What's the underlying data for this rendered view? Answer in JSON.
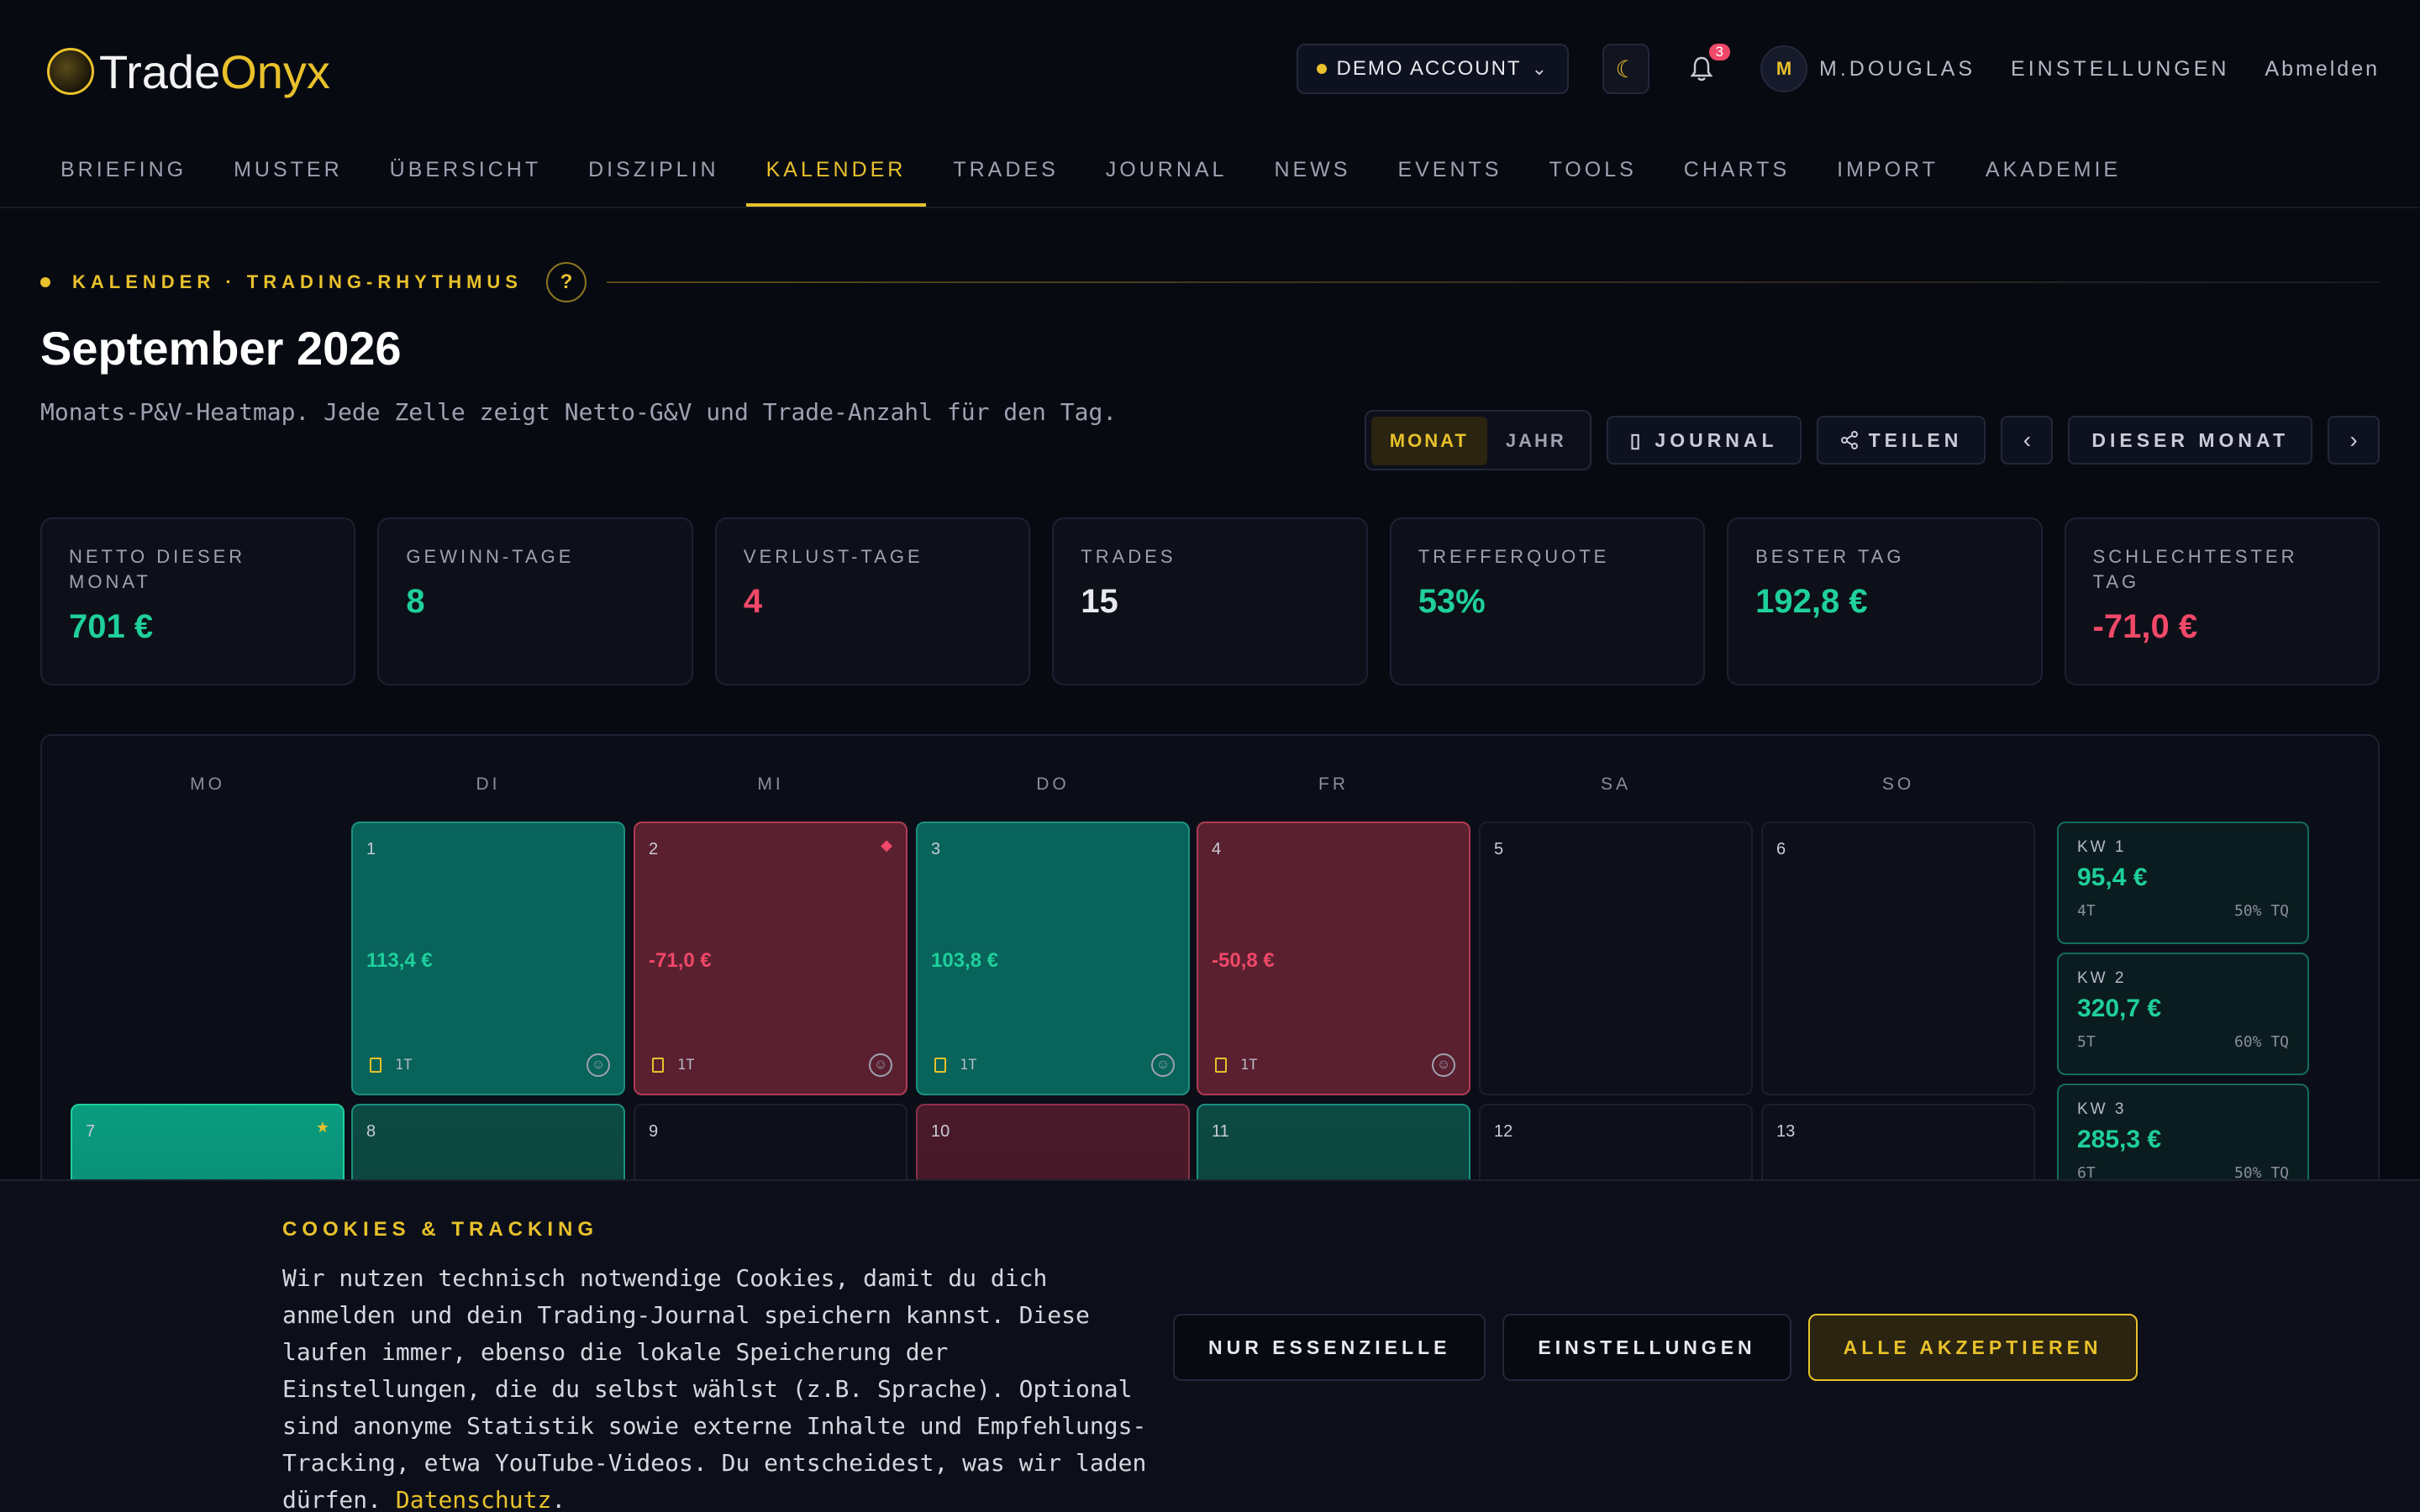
{
  "header": {
    "logo_part1": "Trade",
    "logo_part2": "Onyx",
    "account_label": "DEMO ACCOUNT",
    "notification_count": "3",
    "avatar_initial": "M",
    "user_name": "M.DOUGLAS",
    "settings_label": "EINSTELLUNGEN",
    "logout_label": "Abmelden"
  },
  "nav": {
    "items": [
      "BRIEFING",
      "MUSTER",
      "ÜBERSICHT",
      "DISZIPLIN",
      "KALENDER",
      "TRADES",
      "JOURNAL",
      "NEWS",
      "EVENTS",
      "TOOLS",
      "CHARTS",
      "IMPORT",
      "AKADEMIE"
    ],
    "active": "KALENDER"
  },
  "page": {
    "eyebrow": "KALENDER · TRADING-RHYTHMUS",
    "help": "?",
    "title": "September 2026",
    "description": "Monats-P&V-Heatmap. Jede Zelle zeigt Netto-G&V und Trade-Anzahl für den Tag."
  },
  "toolbar": {
    "view_month": "MONAT",
    "view_year": "JAHR",
    "journal": "JOURNAL",
    "share": "TEILEN",
    "this_month": "DIESER MONAT"
  },
  "stats": [
    {
      "label": "NETTO DIESER MONAT",
      "value": "701 €",
      "tone": "green"
    },
    {
      "label": "GEWINN-TAGE",
      "value": "8",
      "tone": "green"
    },
    {
      "label": "VERLUST-TAGE",
      "value": "4",
      "tone": "red"
    },
    {
      "label": "TRADES",
      "value": "15",
      "tone": "white"
    },
    {
      "label": "TREFFERQUOTE",
      "value": "53%",
      "tone": "green"
    },
    {
      "label": "BESTER TAG",
      "value": "192,8 €",
      "tone": "green"
    },
    {
      "label": "SCHLECHTESTER TAG",
      "value": "-71,0 €",
      "tone": "red"
    }
  ],
  "calendar": {
    "weekdays": [
      "MO",
      "DI",
      "MI",
      "DO",
      "FR",
      "SA",
      "SO"
    ],
    "days": [
      {
        "num": "1",
        "pnl": "113,4 €",
        "trades": "1T",
        "state": "win"
      },
      {
        "num": "2",
        "pnl": "-71,0 €",
        "trades": "1T",
        "state": "loss",
        "mark": "◆"
      },
      {
        "num": "3",
        "pnl": "103,8 €",
        "trades": "1T",
        "state": "win"
      },
      {
        "num": "4",
        "pnl": "-50,8 €",
        "trades": "1T",
        "state": "loss"
      },
      {
        "num": "5"
      },
      {
        "num": "6"
      },
      {
        "num": "7",
        "state": "bigwin",
        "mark": "★"
      },
      {
        "num": "8",
        "state": "midwin"
      },
      {
        "num": "9"
      },
      {
        "num": "10",
        "state": "midloss"
      },
      {
        "num": "11",
        "state": "midwin"
      },
      {
        "num": "12"
      },
      {
        "num": "13"
      }
    ],
    "weeks": [
      {
        "label": "KW 1",
        "value": "95,4 €",
        "days": "4T",
        "rate": "50% TQ"
      },
      {
        "label": "KW 2",
        "value": "320,7 €",
        "days": "5T",
        "rate": "60% TQ"
      },
      {
        "label": "KW 3",
        "value": "285,3 €",
        "days": "6T",
        "rate": "50% TQ"
      }
    ]
  },
  "cookie": {
    "title": "COOKIES & TRACKING",
    "text": "Wir nutzen technisch notwendige Cookies, damit du dich anmelden und dein Trading-Journal speichern kannst. Diese laufen immer, ebenso die lokale Speicherung der Einstellungen, die du selbst wählst (z.B. Sprache). Optional sind anonyme Statistik sowie externe Inhalte und Empfehlungs-Tracking, etwa YouTube-Videos. Du entscheidest, was wir laden dürfen.",
    "link": "Datenschutz",
    "link_suffix": ".",
    "btn_essential": "NUR ESSENZIELLE",
    "btn_settings": "EINSTELLUNGEN",
    "btn_accept": "ALLE AKZEPTIEREN"
  },
  "colors": {
    "accent": "#e8c12b",
    "positive": "#1fcf9c",
    "negative": "#f04868",
    "background": "#080a12"
  }
}
